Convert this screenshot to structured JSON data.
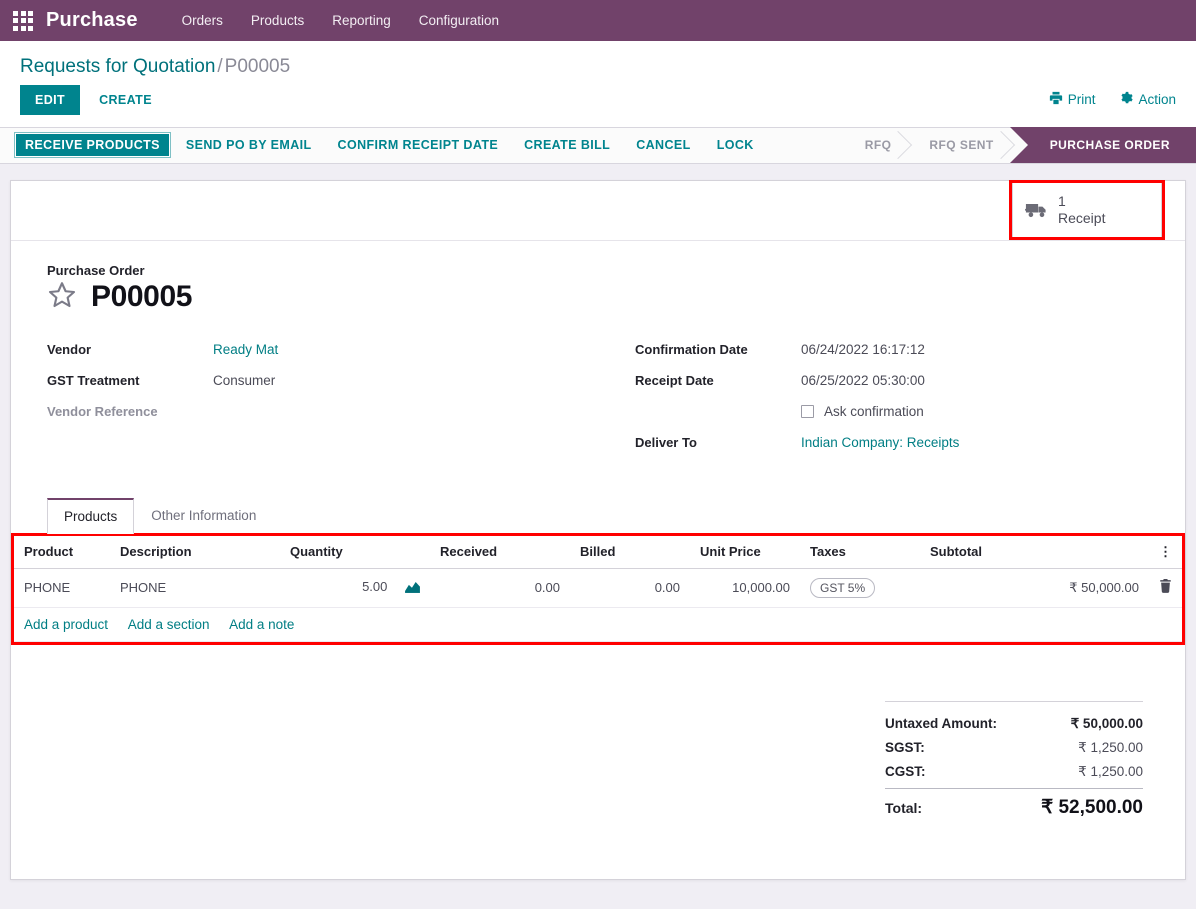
{
  "navbar": {
    "apps_icon": "apps-grid-icon",
    "brand": "Purchase",
    "menu": [
      {
        "label": "Orders"
      },
      {
        "label": "Products"
      },
      {
        "label": "Reporting"
      },
      {
        "label": "Configuration"
      }
    ]
  },
  "control_panel": {
    "breadcrumb_root": "Requests for Quotation",
    "breadcrumb_sep": "/",
    "breadcrumb_current": "P00005",
    "edit_label": "EDIT",
    "create_label": "CREATE",
    "print_label": "Print",
    "print_icon": "printer-icon",
    "action_label": "Action",
    "action_icon": "gear-icon"
  },
  "statusbar": {
    "buttons": [
      {
        "label": "RECEIVE PRODUCTS",
        "primary": true
      },
      {
        "label": "SEND PO BY EMAIL",
        "primary": false
      },
      {
        "label": "CONFIRM RECEIPT DATE",
        "primary": false
      },
      {
        "label": "CREATE BILL",
        "primary": false
      },
      {
        "label": "CANCEL",
        "primary": false
      },
      {
        "label": "LOCK",
        "primary": false
      }
    ],
    "pipeline": [
      {
        "label": "RFQ",
        "active": false
      },
      {
        "label": "RFQ SENT",
        "active": false
      },
      {
        "label": "PURCHASE ORDER",
        "active": true
      }
    ]
  },
  "smart_buttons": [
    {
      "icon": "truck-icon",
      "value": "1",
      "label": "Receipt",
      "highlighted": true
    }
  ],
  "record": {
    "form_label": "Purchase Order",
    "star_icon": "star-outline-icon",
    "title": "P00005"
  },
  "fields_left": [
    {
      "label": "Vendor",
      "value": "Ready Mat",
      "type": "link"
    },
    {
      "label": "GST Treatment",
      "value": "Consumer",
      "type": "text"
    },
    {
      "label": "Vendor Reference",
      "value": "",
      "type": "empty"
    }
  ],
  "fields_right": [
    {
      "label": "Confirmation Date",
      "value": "06/24/2022 16:17:12",
      "type": "text"
    },
    {
      "label": "Receipt Date",
      "value": "06/25/2022 05:30:00",
      "type": "text"
    },
    {
      "label": "",
      "value": "Ask confirmation",
      "type": "checkbox",
      "checked": false
    },
    {
      "label": "Deliver To",
      "value": "Indian Company: Receipts",
      "type": "link"
    }
  ],
  "notebook": {
    "tabs": [
      {
        "label": "Products",
        "active": true
      },
      {
        "label": "Other Information",
        "active": false
      }
    ],
    "optional_columns_icon": "vertical-dots-icon",
    "columns": [
      "Product",
      "Description",
      "Quantity",
      "Received",
      "Billed",
      "Unit Price",
      "Taxes",
      "Subtotal"
    ],
    "rows": [
      {
        "product": "PHONE",
        "description": "PHONE",
        "quantity": "5.00",
        "quantity_icon": "area-chart-icon",
        "received": "0.00",
        "billed": "0.00",
        "unit_price": "10,000.00",
        "taxes": "GST 5%",
        "subtotal": "₹ 50,000.00",
        "delete_icon": "trash-icon"
      }
    ],
    "add_links": [
      {
        "label": "Add a product"
      },
      {
        "label": "Add a section"
      },
      {
        "label": "Add a note"
      }
    ]
  },
  "totals": [
    {
      "label": "Untaxed Amount:",
      "value": "₹ 50,000.00",
      "emphasis": "strong"
    },
    {
      "label": "SGST:",
      "value": "₹ 1,250.00",
      "emphasis": "normal"
    },
    {
      "label": "CGST:",
      "value": "₹ 1,250.00",
      "emphasis": "normal"
    },
    {
      "label": "Total:",
      "value": "₹ 52,500.00",
      "emphasis": "grand"
    }
  ],
  "colors": {
    "navbar_purple": "#71426a",
    "accent_teal": "#00848e",
    "link_teal": "#017e84",
    "highlight_red": "#ff0000",
    "page_bg": "#f0eef4"
  }
}
